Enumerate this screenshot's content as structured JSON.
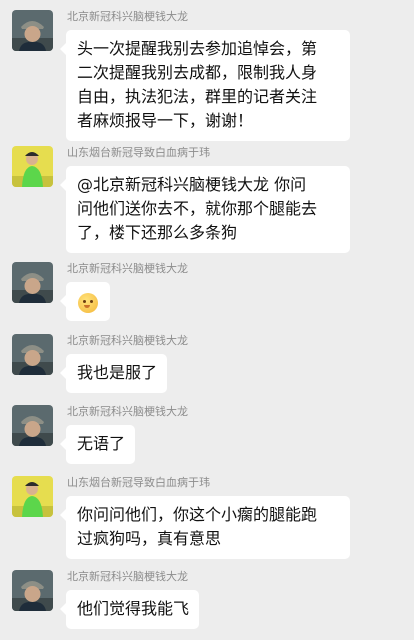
{
  "messages": [
    {
      "sender": "北京新冠科兴脑梗钱大龙",
      "avatar": "avatar-man-cap",
      "lines": [
        "头一次提醒我别去参加追悼会，第",
        "二次提醒我别去成都，限制我人身",
        "自由，执法犯法，群里的记者关注",
        "者麻烦报导一下，谢谢！"
      ]
    },
    {
      "sender": "山东烟台新冠导致白血病于玮",
      "avatar": "avatar-green-figure",
      "lines": [
        "@北京新冠科兴脑梗钱大龙  你问",
        "问他们送你去不，就你那个腿能去",
        "了，楼下还那么多条狗"
      ]
    },
    {
      "sender": "北京新冠科兴脑梗钱大龙",
      "avatar": "avatar-man-cap",
      "emoji": "thinking-face-emoji"
    },
    {
      "sender": "北京新冠科兴脑梗钱大龙",
      "avatar": "avatar-man-cap",
      "lines": [
        "我也是服了"
      ]
    },
    {
      "sender": "北京新冠科兴脑梗钱大龙",
      "avatar": "avatar-man-cap",
      "lines": [
        "无语了"
      ]
    },
    {
      "sender": "山东烟台新冠导致白血病于玮",
      "avatar": "avatar-green-figure",
      "lines": [
        "你问问他们，你这个小瘸的腿能跑",
        "过疯狗吗，真有意思"
      ]
    },
    {
      "sender": "北京新冠科兴脑梗钱大龙",
      "avatar": "avatar-man-cap",
      "lines": [
        "他们觉得我能飞"
      ]
    }
  ]
}
